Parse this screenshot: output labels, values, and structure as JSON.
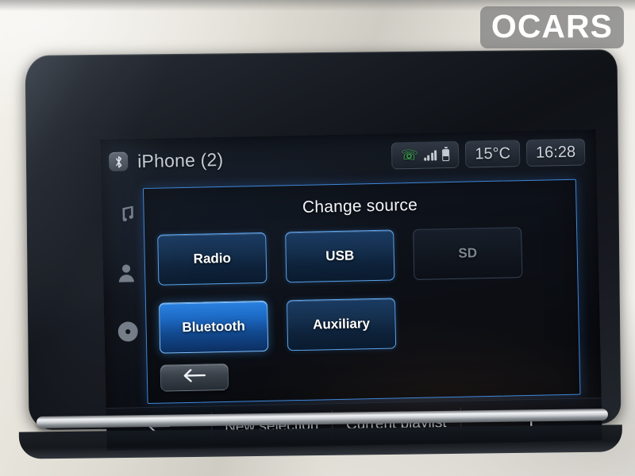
{
  "watermark": {
    "text": "OCARS"
  },
  "statusbar": {
    "bluetooth_icon": "bluetooth-icon",
    "device_name": "iPhone (2)",
    "phone_icon": "phone-icon",
    "signal_icon": "signal-bars-icon",
    "battery_icon": "battery-icon",
    "temperature": "15°C",
    "clock": "16:28"
  },
  "sidebar": {
    "items": [
      {
        "name": "music",
        "icon": "music-note-icon"
      },
      {
        "name": "contacts",
        "icon": "person-icon"
      },
      {
        "name": "disc",
        "icon": "disc-icon"
      }
    ]
  },
  "dialog": {
    "title": "Change source",
    "back_icon": "arrow-left-icon",
    "sources": [
      {
        "label": "Radio",
        "state": "enabled"
      },
      {
        "label": "USB",
        "state": "enabled"
      },
      {
        "label": "SD",
        "state": "disabled"
      },
      {
        "label": "Bluetooth",
        "state": "selected"
      },
      {
        "label": "Auxiliary",
        "state": "enabled"
      }
    ]
  },
  "bottombar": {
    "back_icon": "arrow-left-icon",
    "new_selection": "New selection",
    "current_playlist": "Current playlist",
    "add_icon": "plus-icon",
    "add_label": "+"
  },
  "colors": {
    "accent_blue": "#3f86d8",
    "selected_blue": "#1d6cc8",
    "border_blue": "#5aa4ec",
    "disabled_text": "#7c858f",
    "text_primary": "#ffffff",
    "text_secondary": "#c6ccd4",
    "screen_bg": "#0b0e14",
    "phone_green": "#3fd152"
  }
}
